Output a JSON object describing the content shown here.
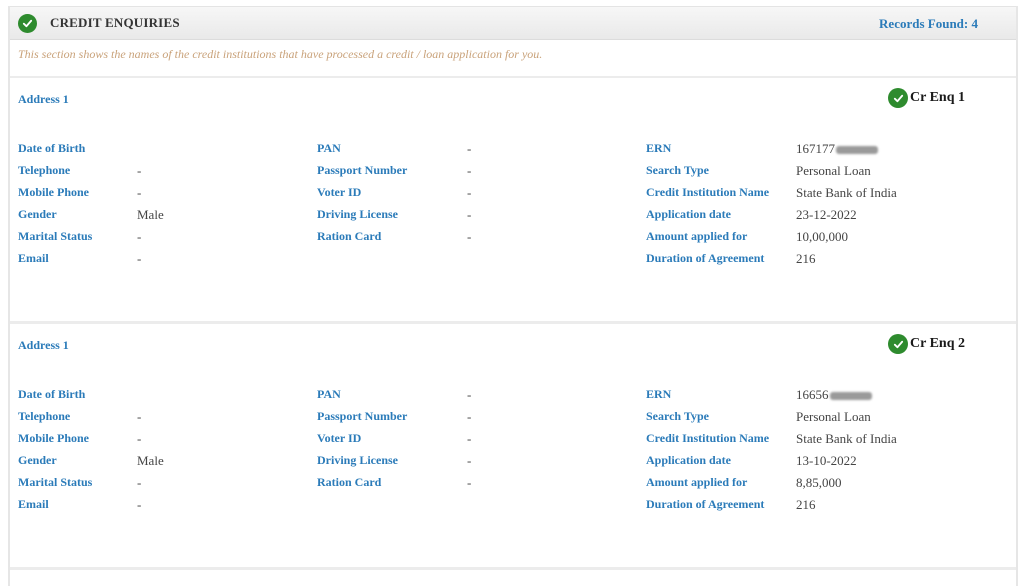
{
  "section": {
    "title": "CREDIT ENQUIRIES",
    "icon": "check-circle-icon",
    "records_found": "Records Found: 4",
    "description": "This section shows the names of the credit institutions that have processed a credit / loan application for you."
  },
  "colors": {
    "label_blue": "#2b7bb9",
    "check_green": "#2e8b2e",
    "description_tan": "#c9a27a"
  },
  "records": [
    {
      "address_label": "Address 1",
      "enquiry_label": "Cr Enq 1",
      "personal": [
        {
          "label": "Date of Birth",
          "value": ""
        },
        {
          "label": "Telephone",
          "value": "-"
        },
        {
          "label": "Mobile Phone",
          "value": "-"
        },
        {
          "label": "Gender",
          "value": "Male"
        },
        {
          "label": "Marital Status",
          "value": "-"
        },
        {
          "label": "Email",
          "value": "-"
        }
      ],
      "ids": [
        {
          "label": "PAN",
          "value": "-"
        },
        {
          "label": "Passport Number",
          "value": "-"
        },
        {
          "label": "Voter ID",
          "value": "-"
        },
        {
          "label": "Driving License",
          "value": "-"
        },
        {
          "label": "Ration Card",
          "value": "-"
        }
      ],
      "enquiry": [
        {
          "label": "ERN",
          "value": "167177",
          "masked": true
        },
        {
          "label": "Search Type",
          "value": "Personal Loan"
        },
        {
          "label": "Credit Institution Name",
          "value": "State Bank of India"
        },
        {
          "label": "Application date",
          "value": "23-12-2022"
        },
        {
          "label": "Amount applied for",
          "value": "10,00,000"
        },
        {
          "label": "Duration of Agreement",
          "value": "216"
        }
      ]
    },
    {
      "address_label": "Address 1",
      "enquiry_label": "Cr Enq 2",
      "personal": [
        {
          "label": "Date of Birth",
          "value": ""
        },
        {
          "label": "Telephone",
          "value": "-"
        },
        {
          "label": "Mobile Phone",
          "value": "-"
        },
        {
          "label": "Gender",
          "value": "Male"
        },
        {
          "label": "Marital Status",
          "value": "-"
        },
        {
          "label": "Email",
          "value": "-"
        }
      ],
      "ids": [
        {
          "label": "PAN",
          "value": "-"
        },
        {
          "label": "Passport Number",
          "value": "-"
        },
        {
          "label": "Voter ID",
          "value": "-"
        },
        {
          "label": "Driving License",
          "value": "-"
        },
        {
          "label": "Ration Card",
          "value": "-"
        }
      ],
      "enquiry": [
        {
          "label": "ERN",
          "value": "16656",
          "masked": true
        },
        {
          "label": "Search Type",
          "value": "Personal Loan"
        },
        {
          "label": "Credit Institution Name",
          "value": "State Bank of India"
        },
        {
          "label": "Application date",
          "value": "13-10-2022"
        },
        {
          "label": "Amount applied for",
          "value": "8,85,000"
        },
        {
          "label": "Duration of Agreement",
          "value": "216"
        }
      ]
    }
  ]
}
